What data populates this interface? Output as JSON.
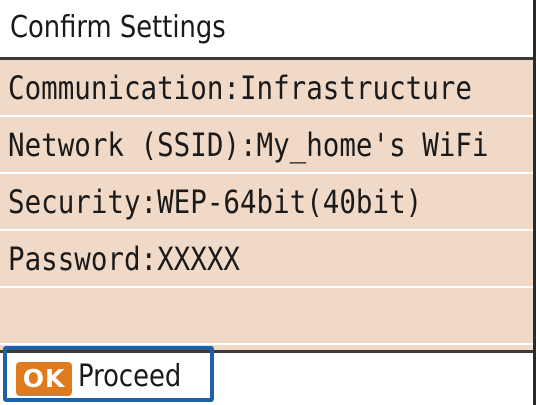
{
  "screen": {
    "title": "Confirm Settings",
    "rows": [
      {
        "text": "Communication:Infrastructure"
      },
      {
        "text": "Network (SSID):My_home's WiFi"
      },
      {
        "text": "Security:WEP-64bit(40bit)"
      },
      {
        "text": "Password:XXXXX"
      },
      {
        "text": ""
      }
    ]
  },
  "footer": {
    "ok_badge": "OK",
    "proceed_label": "Proceed"
  },
  "colors": {
    "content_background": "#f1d9c8",
    "ok_badge": "#e07a1e",
    "focus_border": "#1f5fa8"
  }
}
